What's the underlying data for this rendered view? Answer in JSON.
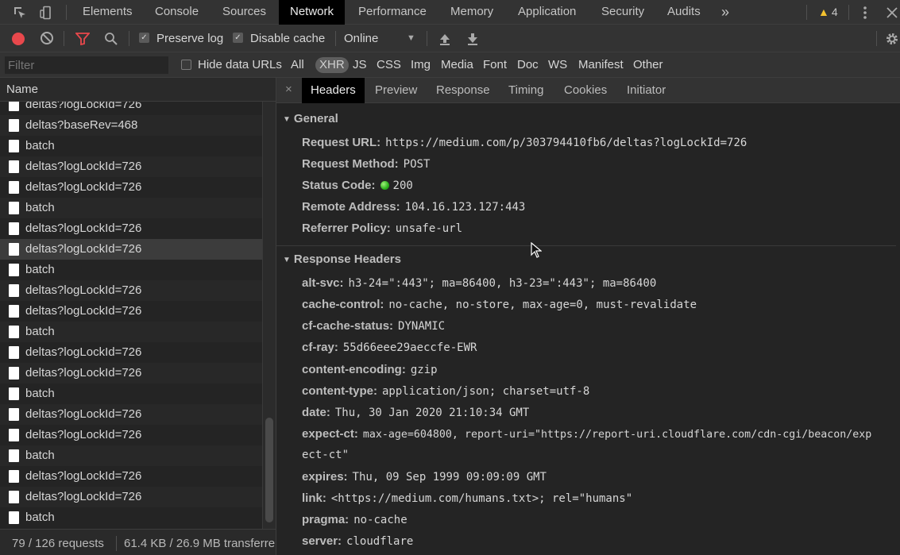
{
  "tabbar": {
    "tabs": [
      "Elements",
      "Console",
      "Sources",
      "Network",
      "Performance",
      "Memory",
      "Application",
      "Security",
      "Audits"
    ],
    "active_tab": "Network",
    "more": "»",
    "warning_count": "4"
  },
  "toolbar": {
    "preserve_log": "Preserve log",
    "disable_cache": "Disable cache",
    "throttle": "Online"
  },
  "filterbar": {
    "placeholder": "Filter",
    "hide_data_urls": "Hide data URLs",
    "types": [
      "All",
      "XHR",
      "JS",
      "CSS",
      "Img",
      "Media",
      "Font",
      "Doc",
      "WS",
      "Manifest",
      "Other"
    ],
    "active_type": "XHR"
  },
  "requests": {
    "header": "Name",
    "rows": [
      "deltas?logLockId=726",
      "deltas?baseRev=468",
      "batch",
      "deltas?logLockId=726",
      "deltas?logLockId=726",
      "batch",
      "deltas?logLockId=726",
      "deltas?logLockId=726",
      "batch",
      "deltas?logLockId=726",
      "deltas?logLockId=726",
      "batch",
      "deltas?logLockId=726",
      "deltas?logLockId=726",
      "batch",
      "deltas?logLockId=726",
      "deltas?logLockId=726",
      "batch",
      "deltas?logLockId=726",
      "deltas?logLockId=726",
      "batch"
    ],
    "selected_index": 7,
    "summary_count": "79 / 126 requests",
    "summary_size": "61.4 KB / 26.9 MB transferre"
  },
  "details": {
    "close": "×",
    "tabs": [
      "Headers",
      "Preview",
      "Response",
      "Timing",
      "Cookies",
      "Initiator"
    ],
    "active_tab": "Headers",
    "general_title": "General",
    "general": [
      {
        "k": "Request URL:",
        "v": "https://medium.com/p/303794410fb6/deltas?logLockId=726"
      },
      {
        "k": "Request Method:",
        "v": "POST"
      },
      {
        "k": "Status Code:",
        "v": "200"
      },
      {
        "k": "Remote Address:",
        "v": "104.16.123.127:443"
      },
      {
        "k": "Referrer Policy:",
        "v": "unsafe-url"
      }
    ],
    "response_title": "Response Headers",
    "response": [
      {
        "k": "alt-svc:",
        "v": "h3-24=\":443\"; ma=86400, h3-23=\":443\"; ma=86400"
      },
      {
        "k": "cache-control:",
        "v": "no-cache, no-store, max-age=0, must-revalidate"
      },
      {
        "k": "cf-cache-status:",
        "v": "DYNAMIC"
      },
      {
        "k": "cf-ray:",
        "v": "55d66eee29aeccfe-EWR"
      },
      {
        "k": "content-encoding:",
        "v": "gzip"
      },
      {
        "k": "content-type:",
        "v": "application/json; charset=utf-8"
      },
      {
        "k": "date:",
        "v": "Thu, 30 Jan 2020 21:10:34 GMT"
      },
      {
        "k": "expect-ct:",
        "v": "max-age=604800, report-uri=\"https://report-uri.cloudflare.com/cdn-cgi/beacon/exp",
        "v2": "ect-ct\""
      },
      {
        "k": "expires:",
        "v": "Thu, 09 Sep 1999 09:09:09 GMT"
      },
      {
        "k": "link:",
        "v": "<https://medium.com/humans.txt>; rel=\"humans\""
      },
      {
        "k": "pragma:",
        "v": "no-cache"
      },
      {
        "k": "server:",
        "v": "cloudflare"
      }
    ]
  }
}
